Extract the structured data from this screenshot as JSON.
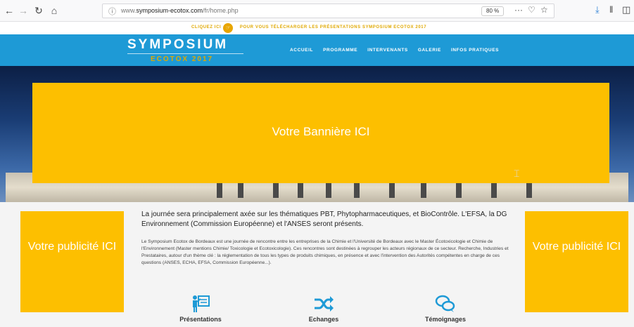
{
  "browser": {
    "back_icon": "arrow-left-icon",
    "forward_icon": "arrow-right-icon",
    "reload_icon": "reload-icon",
    "home_icon": "home-icon",
    "url_prefix": "www.",
    "url_domain": "symposium-ecotox.com",
    "url_path": "/fr/home.php",
    "zoom": "80 %",
    "page_actions": "···"
  },
  "notice": {
    "before": "CLIQUEZ ICI",
    "after": "POUR VOUS TÉLÉCHARGER LES PRÉSENTATIONS SYMPOSIUM ECOTOX 2017"
  },
  "site": {
    "title": "SYMPOSIUM",
    "subtitle": "ECOTOX 2017",
    "nav": [
      "ACCUEIL",
      "PROGRAMME",
      "INTERVENANTS",
      "GALERIE",
      "INFOS PRATIQUES"
    ]
  },
  "banner": {
    "text": "Votre Bannière ICI"
  },
  "ads": {
    "left": "Votre publicité ICI",
    "right": "Votre publicité ICI"
  },
  "intro": {
    "lead": "La journée sera principalement axée sur les thématiques PBT, Phytopharmaceutiques, et BioContrôle. L'EFSA, la DG Environnement (Commission Européenne) et l'ANSES seront présents.",
    "body": "Le Symposium Ecotox de Bordeaux est une journée de rencontre entre les entreprises de la Chimie et l'Université de Bordeaux avec le Master Écotoxicologie et Chimie de l'Environnement (Master mentions Chimie/ Toxicologie et Ecotoxicologie). Ces rencontres sont destinées à regrouper les acteurs régionaux de ce secteur. Recherche, Industries et Prestataires, autour d'un thème clé : la réglementation de tous les types de produits chimiques, en présence et avec l'intervention des Autorités compétentes en charge de ces questions (ANSES, ECHA, EFSA, Commission Européenne...)."
  },
  "features": [
    {
      "label": "Présentations",
      "icon": "presentation-icon"
    },
    {
      "label": "Echanges",
      "icon": "shuffle-icon"
    },
    {
      "label": "Témoignages",
      "icon": "chat-icon"
    }
  ]
}
